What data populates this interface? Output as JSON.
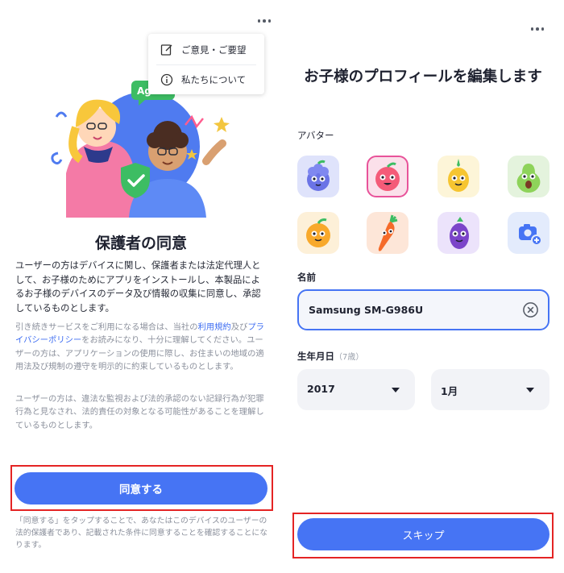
{
  "left": {
    "menu": {
      "items": [
        {
          "label": "ご意見・ご要望",
          "icon": "edit-icon"
        },
        {
          "label": "私たちについて",
          "icon": "info-icon"
        }
      ]
    },
    "illustration_badge": "Agree",
    "title": "保護者の同意",
    "body_strong": "ユーザーの方はデバイスに関し、保護者または法定代理人として、お子様のためにアプリをインストールし、本製品によるお子様のデバイスのデータ及び情報の収集に同意し、承認しているものとします。",
    "p2": {
      "a": "引き続きサービスをご利用になる場合は、当社の",
      "link1": "利用規約",
      "b": "及び",
      "link2": "プライバシーポリシー",
      "c": "をお読みになり、十分に理解してください。ユーザーの方は、アプリケーションの使用に際し、お住まいの地域の適用法及び規制の遵守を明示的に約束しているものとします。"
    },
    "p3": "ユーザーの方は、違法な監視および法的承認のない記録行為が犯罪行為と見なされ、法的責任の対象となる可能性があることを理解しているものとします。",
    "agree_button": "同意する",
    "fine_print": "「同意する」をタップすることで、あなたはこのデバイスのユーザーの法的保護者であり、記載された条件に同意することを確認することになります。"
  },
  "right": {
    "title": "お子様のプロフィールを編集します",
    "avatar_label": "アバター",
    "avatars": [
      {
        "name": "grape-avatar",
        "bg": "#dfe3fb",
        "selected": false
      },
      {
        "name": "apple-avatar",
        "bg": "#fbe0ea",
        "selected": true
      },
      {
        "name": "pineapple-avatar",
        "bg": "#fdf5d8",
        "selected": false
      },
      {
        "name": "pear-avatar",
        "bg": "#e4f3dd",
        "selected": false
      },
      {
        "name": "orange-avatar",
        "bg": "#fdf0d8",
        "selected": false
      },
      {
        "name": "carrot-avatar",
        "bg": "#fde6d8",
        "selected": false
      },
      {
        "name": "eggplant-avatar",
        "bg": "#ece3fb",
        "selected": false
      },
      {
        "name": "camera-add-avatar",
        "bg": "#e3ebfc",
        "selected": false
      }
    ],
    "name_label": "名前",
    "name_value": "Samsung SM-G986U",
    "birth_label": "生年月日",
    "age_note": "（7歳）",
    "year_value": "2017",
    "month_value": "1月",
    "skip_button": "スキップ"
  },
  "colors": {
    "primary": "#4674f4",
    "link": "#3f6ef2",
    "highlight_frame": "#e42424",
    "selected_avatar": "#e8539a"
  }
}
